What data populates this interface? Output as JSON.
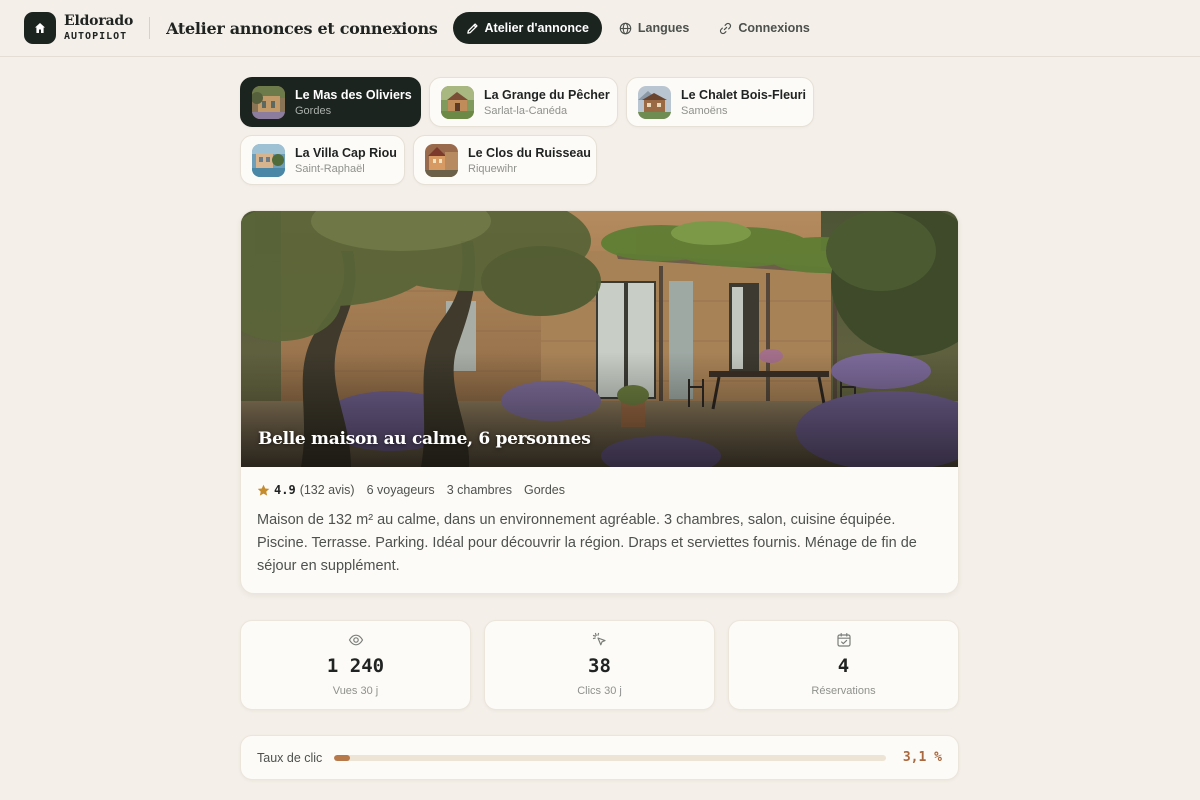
{
  "header": {
    "brand_name": "Eldorado",
    "brand_sub": "AUTOPILOT",
    "title": "Atelier annonces et connexions",
    "nav": [
      {
        "label": "Atelier d'annonce",
        "icon": "pencil-icon",
        "active": true
      },
      {
        "label": "Langues",
        "icon": "globe-icon",
        "active": false
      },
      {
        "label": "Connexions",
        "icon": "link-icon",
        "active": false
      }
    ]
  },
  "properties": [
    {
      "name": "Le Mas des Oliviers",
      "location": "Gordes",
      "selected": true
    },
    {
      "name": "La Grange du Pêcher",
      "location": "Sarlat-la-Canéda",
      "selected": false
    },
    {
      "name": "Le Chalet Bois-Fleuri",
      "location": "Samoëns",
      "selected": false
    },
    {
      "name": "La Villa Cap Riou",
      "location": "Saint-Raphaël",
      "selected": false
    },
    {
      "name": "Le Clos du Ruisseau",
      "location": "Riquewihr",
      "selected": false
    }
  ],
  "listing": {
    "title": "Belle maison au calme, 6 personnes",
    "rating": "4.9",
    "reviews": "(132 avis)",
    "guests": "6 voyageurs",
    "bedrooms": "3 chambres",
    "location": "Gordes",
    "description": "Maison de 132 m² au calme, dans un environnement agréable. 3 chambres, salon, cuisine équipée. Piscine. Terrasse. Parking. Idéal pour découvrir la région. Draps et serviettes fournis. Ménage de fin de séjour en supplément."
  },
  "stats": [
    {
      "icon": "eye-icon",
      "value": "1 240",
      "label": "Vues 30 j"
    },
    {
      "icon": "cursor-click-icon",
      "value": "38",
      "label": "Clics 30 j"
    },
    {
      "icon": "calendar-check-icon",
      "value": "4",
      "label": "Réservations"
    }
  ],
  "ctr": {
    "label": "Taux de clic",
    "value": "3,1 %",
    "fraction": 0.031
  },
  "colors": {
    "accent_dark": "#1c2420",
    "accent_copper": "#b8794a",
    "background": "#f4efe8",
    "card": "#fdfbf7"
  }
}
